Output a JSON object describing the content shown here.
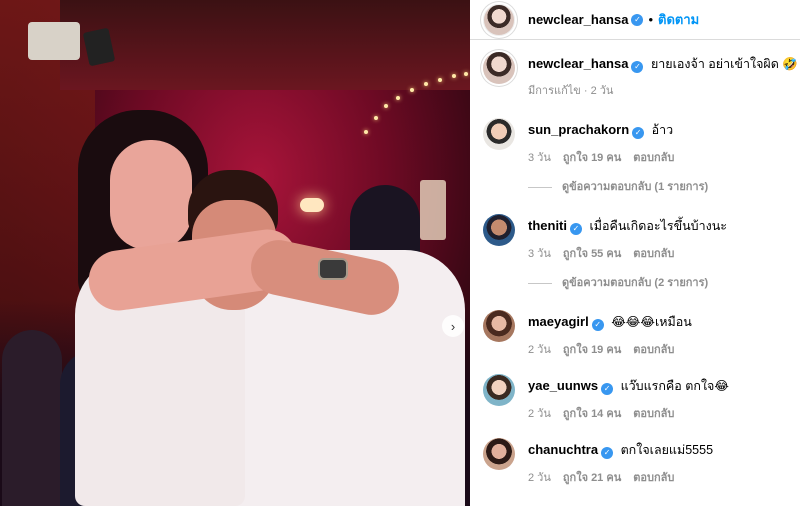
{
  "post": {
    "author": "newclear_hansa",
    "follow_label": "ติดตาม",
    "separator": "•"
  },
  "caption": {
    "username": "newclear_hansa",
    "text": "ยายเองจ้า อย่าเข้าใจผิด 🤣",
    "meta": "มีการแก้ไข · 2 วัน"
  },
  "comments": [
    {
      "username": "sun_prachakorn",
      "verified": true,
      "text": "อ้าว",
      "time": "3 วัน",
      "likes": "ถูกใจ 19 คน",
      "reply": "ตอบกลับ",
      "replies_label": "ดูข้อความตอบกลับ (1 รายการ)"
    },
    {
      "username": "theniti",
      "verified": true,
      "text": "เมื่อคืนเกิดอะไรขึ้นบ้างนะ",
      "time": "3 วัน",
      "likes": "ถูกใจ 55 คน",
      "reply": "ตอบกลับ",
      "replies_label": "ดูข้อความตอบกลับ (2 รายการ)"
    },
    {
      "username": "maeyagirl",
      "verified": true,
      "text": "😂😂😂เหมือน",
      "time": "2 วัน",
      "likes": "ถูกใจ 19 คน",
      "reply": "ตอบกลับ"
    },
    {
      "username": "yae_uunws",
      "verified": true,
      "text": "แว๊บแรกคือ ตกใจ😂",
      "time": "2 วัน",
      "likes": "ถูกใจ 14 คน",
      "reply": "ตอบกลับ"
    },
    {
      "username": "chanuchtra",
      "verified": true,
      "text": "ตกใจเลยแม่5555",
      "time": "2 วัน",
      "likes": "ถูกใจ 21 คน",
      "reply": "ตอบกลับ"
    }
  ],
  "icons": {
    "verified": "verified-badge-icon",
    "next": "chevron-right-icon",
    "verified_glyph": "✓",
    "next_glyph": "›"
  },
  "colors": {
    "follow": "#0095f6",
    "verified": "#3897f0",
    "muted": "#8e8e8e"
  }
}
